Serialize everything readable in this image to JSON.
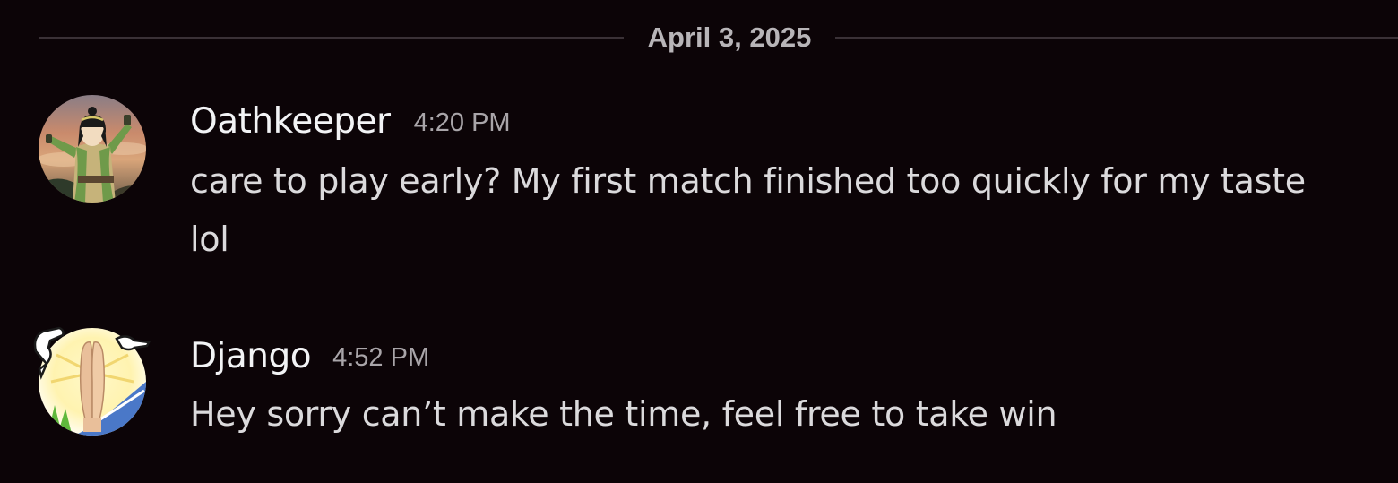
{
  "divider": {
    "date": "April 3, 2025"
  },
  "messages": [
    {
      "username": "Oathkeeper",
      "timestamp": "4:20 PM",
      "content": "care to play early? My first match finished too quickly for my taste lol",
      "avatar": "avatar-character-icon"
    },
    {
      "username": "Django",
      "timestamp": "4:52 PM",
      "content": "Hey sorry can’t make the time, feel free to take win",
      "avatar": "avatar-praying-hands-icon"
    }
  ],
  "colors": {
    "background": "#0c0407",
    "username": "#f2f3f5",
    "timestamp": "#a9a5a9",
    "message_text": "#dbdadc",
    "divider_line": "#3a3136",
    "divider_text": "#b8b5b8"
  }
}
